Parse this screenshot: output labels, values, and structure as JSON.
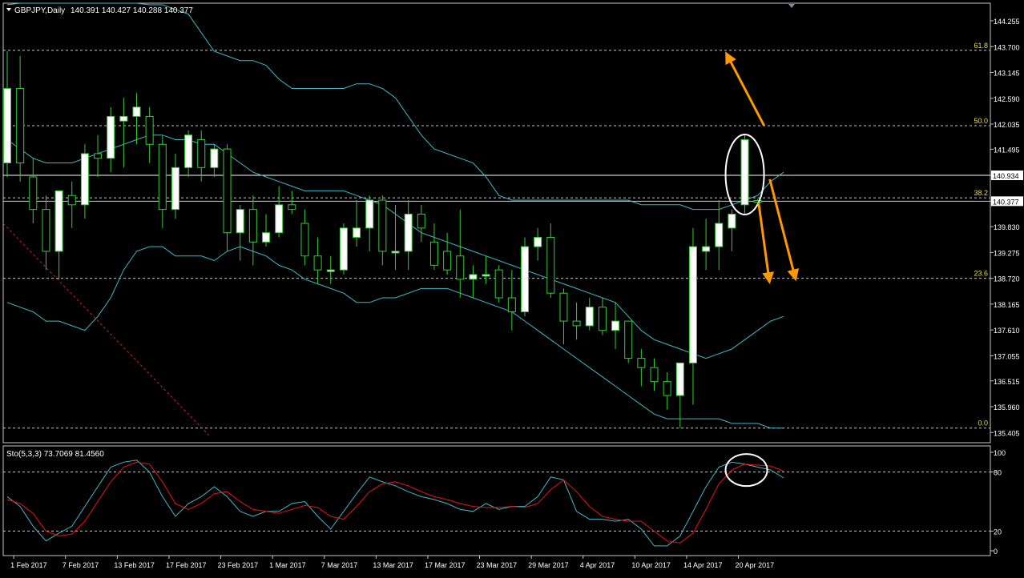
{
  "header": {
    "symbol_label": "GBPJPY,Daily",
    "ohlc_label": "140.391 140.427 140.288 140.377"
  },
  "colors": {
    "background": "#000000",
    "frame": "#c8c8c8",
    "bull_body": "#ffffff",
    "bear_body": "#000000",
    "wick": "#33cc33",
    "bollinger": "#40b8c8",
    "fib_line": "#c8c8c8",
    "fib_label": "#e8e040",
    "trendline": "#cc2222",
    "arrow": "#ff9900",
    "ellipse": "#ffffff",
    "sto_main": "#40b8c8",
    "sto_signal": "#ee1111",
    "axis_text": "#ffffff"
  },
  "chart_data": [
    {
      "type": "candlestick",
      "title": "GBPJPY,Daily",
      "ylim": [
        135.405,
        144.8
      ],
      "y_ticks": [
        "144.255",
        "143.700",
        "143.145",
        "142.590",
        "142.035",
        "141.495",
        "140.934",
        "140.377",
        "139.830",
        "139.275",
        "138.720",
        "138.165",
        "137.610",
        "137.055",
        "136.515",
        "135.960",
        "135.405"
      ],
      "x_tick_labels": [
        "1 Feb 2017",
        "7 Feb 2017",
        "13 Feb 2017",
        "17 Feb 2017",
        "23 Feb 2017",
        "1 Mar 2017",
        "7 Mar 2017",
        "13 Mar 2017",
        "17 Mar 2017",
        "23 Mar 2017",
        "29 Mar 2017",
        "4 Apr 2017",
        "10 Apr 2017",
        "14 Apr 2017",
        "20 Apr 2017"
      ],
      "highlighted_prices": [
        "140.934",
        "140.377"
      ],
      "fibonacci_levels": [
        {
          "label": "61.8",
          "price": 143.62
        },
        {
          "label": "50.0",
          "price": 142.0
        },
        {
          "label": "38.2",
          "price": 140.45
        },
        {
          "label": "23.6",
          "price": 138.72
        },
        {
          "label": "0.0",
          "price": 135.5
        }
      ],
      "candles": [
        {
          "date": "2017-01-31",
          "open": 141.2,
          "high": 143.6,
          "low": 140.9,
          "close": 142.8
        },
        {
          "date": "2017-02-01",
          "open": 142.8,
          "high": 143.5,
          "low": 140.8,
          "close": 141.2
        },
        {
          "date": "2017-02-02",
          "open": 140.9,
          "high": 141.3,
          "low": 139.9,
          "close": 140.2
        },
        {
          "date": "2017-02-03",
          "open": 140.2,
          "high": 140.5,
          "low": 138.9,
          "close": 139.3
        },
        {
          "date": "2017-02-06",
          "open": 139.3,
          "high": 140.6,
          "low": 138.7,
          "close": 140.6
        },
        {
          "date": "2017-02-07",
          "open": 140.5,
          "high": 140.8,
          "low": 139.8,
          "close": 140.3
        },
        {
          "date": "2017-02-08",
          "open": 140.3,
          "high": 141.6,
          "low": 140.0,
          "close": 141.4
        },
        {
          "date": "2017-02-09",
          "open": 141.4,
          "high": 141.8,
          "low": 140.9,
          "close": 141.3
        },
        {
          "date": "2017-02-10",
          "open": 141.3,
          "high": 142.4,
          "low": 141.0,
          "close": 142.2
        },
        {
          "date": "2017-02-13",
          "open": 142.1,
          "high": 142.6,
          "low": 141.1,
          "close": 142.2
        },
        {
          "date": "2017-02-14",
          "open": 142.2,
          "high": 142.7,
          "low": 141.6,
          "close": 142.4
        },
        {
          "date": "2017-02-15",
          "open": 142.2,
          "high": 142.4,
          "low": 141.2,
          "close": 141.6
        },
        {
          "date": "2017-02-16",
          "open": 141.6,
          "high": 141.8,
          "low": 139.8,
          "close": 140.2
        },
        {
          "date": "2017-02-17",
          "open": 140.2,
          "high": 141.4,
          "low": 140.0,
          "close": 141.1
        },
        {
          "date": "2017-02-20",
          "open": 141.1,
          "high": 141.9,
          "low": 140.9,
          "close": 141.8
        },
        {
          "date": "2017-02-21",
          "open": 141.7,
          "high": 141.9,
          "low": 140.8,
          "close": 141.1
        },
        {
          "date": "2017-02-22",
          "open": 141.1,
          "high": 141.6,
          "low": 140.9,
          "close": 141.5
        },
        {
          "date": "2017-02-23",
          "open": 141.5,
          "high": 141.6,
          "low": 139.3,
          "close": 139.7
        },
        {
          "date": "2017-02-24",
          "open": 139.7,
          "high": 140.3,
          "low": 139.1,
          "close": 140.2
        },
        {
          "date": "2017-02-27",
          "open": 140.2,
          "high": 140.5,
          "low": 139.0,
          "close": 139.5
        },
        {
          "date": "2017-02-28",
          "open": 139.5,
          "high": 140.1,
          "low": 139.4,
          "close": 139.7
        },
        {
          "date": "2017-03-01",
          "open": 139.7,
          "high": 140.7,
          "low": 139.6,
          "close": 140.3
        },
        {
          "date": "2017-03-02",
          "open": 140.3,
          "high": 140.6,
          "low": 140.1,
          "close": 140.2
        },
        {
          "date": "2017-03-03",
          "open": 139.9,
          "high": 140.2,
          "low": 139.0,
          "close": 139.2
        },
        {
          "date": "2017-03-06",
          "open": 139.2,
          "high": 139.6,
          "low": 138.6,
          "close": 138.9
        },
        {
          "date": "2017-03-07",
          "open": 138.9,
          "high": 139.2,
          "low": 138.6,
          "close": 138.9
        },
        {
          "date": "2017-03-08",
          "open": 138.9,
          "high": 139.9,
          "low": 138.8,
          "close": 139.8
        },
        {
          "date": "2017-03-09",
          "open": 139.6,
          "high": 140.4,
          "low": 139.4,
          "close": 139.8
        },
        {
          "date": "2017-03-10",
          "open": 139.8,
          "high": 140.5,
          "low": 139.3,
          "close": 140.4
        },
        {
          "date": "2017-03-13",
          "open": 140.4,
          "high": 140.5,
          "low": 139.0,
          "close": 139.3
        },
        {
          "date": "2017-03-14",
          "open": 139.3,
          "high": 140.3,
          "low": 138.9,
          "close": 139.3
        },
        {
          "date": "2017-03-15",
          "open": 139.3,
          "high": 140.4,
          "low": 138.9,
          "close": 140.1
        },
        {
          "date": "2017-03-16",
          "open": 140.1,
          "high": 140.3,
          "low": 139.5,
          "close": 139.8
        },
        {
          "date": "2017-03-17",
          "open": 139.5,
          "high": 139.9,
          "low": 138.9,
          "close": 139.0
        },
        {
          "date": "2017-03-20",
          "open": 139.3,
          "high": 139.7,
          "low": 138.8,
          "close": 138.9
        },
        {
          "date": "2017-03-21",
          "open": 139.2,
          "high": 140.2,
          "low": 138.3,
          "close": 138.7
        },
        {
          "date": "2017-03-22",
          "open": 138.7,
          "high": 139.0,
          "low": 138.3,
          "close": 138.8
        },
        {
          "date": "2017-03-23",
          "open": 138.8,
          "high": 139.2,
          "low": 138.6,
          "close": 138.8
        },
        {
          "date": "2017-03-24",
          "open": 138.9,
          "high": 139.0,
          "low": 138.2,
          "close": 138.3
        },
        {
          "date": "2017-03-27",
          "open": 138.3,
          "high": 138.9,
          "low": 137.6,
          "close": 138.0
        },
        {
          "date": "2017-03-28",
          "open": 138.0,
          "high": 139.6,
          "low": 137.9,
          "close": 139.4
        },
        {
          "date": "2017-03-29",
          "open": 139.4,
          "high": 139.8,
          "low": 139.1,
          "close": 139.6
        },
        {
          "date": "2017-03-30",
          "open": 139.6,
          "high": 139.9,
          "low": 138.3,
          "close": 138.4
        },
        {
          "date": "2017-03-31",
          "open": 138.4,
          "high": 138.5,
          "low": 137.3,
          "close": 137.8
        },
        {
          "date": "2017-04-03",
          "open": 137.8,
          "high": 138.2,
          "low": 137.4,
          "close": 137.7
        },
        {
          "date": "2017-04-04",
          "open": 137.7,
          "high": 138.3,
          "low": 137.6,
          "close": 138.1
        },
        {
          "date": "2017-04-05",
          "open": 138.1,
          "high": 138.3,
          "low": 137.5,
          "close": 137.6
        },
        {
          "date": "2017-04-06",
          "open": 137.6,
          "high": 138.2,
          "low": 137.2,
          "close": 137.8
        },
        {
          "date": "2017-04-07",
          "open": 137.8,
          "high": 137.8,
          "low": 136.9,
          "close": 137.0
        },
        {
          "date": "2017-04-10",
          "open": 137.0,
          "high": 137.2,
          "low": 136.4,
          "close": 136.8
        },
        {
          "date": "2017-04-11",
          "open": 136.8,
          "high": 137.0,
          "low": 136.3,
          "close": 136.5
        },
        {
          "date": "2017-04-12",
          "open": 136.5,
          "high": 136.7,
          "low": 135.9,
          "close": 136.2
        },
        {
          "date": "2017-04-13",
          "open": 136.2,
          "high": 136.9,
          "low": 135.5,
          "close": 136.9
        },
        {
          "date": "2017-04-14",
          "open": 136.9,
          "high": 139.8,
          "low": 136.0,
          "close": 139.4
        },
        {
          "date": "2017-04-17",
          "open": 139.3,
          "high": 140.0,
          "low": 138.9,
          "close": 139.4
        },
        {
          "date": "2017-04-18",
          "open": 139.4,
          "high": 140.4,
          "low": 138.9,
          "close": 139.9
        },
        {
          "date": "2017-04-19",
          "open": 139.8,
          "high": 140.2,
          "low": 139.3,
          "close": 140.1
        },
        {
          "date": "2017-04-20",
          "open": 140.3,
          "high": 141.8,
          "low": 140.1,
          "close": 141.7
        },
        {
          "date": "2017-04-21",
          "open": 140.391,
          "high": 140.427,
          "low": 140.288,
          "close": 140.377
        }
      ],
      "bollinger": {
        "upper": [
          144.6,
          144.7,
          144.7,
          144.7,
          144.7,
          144.7,
          144.7,
          144.7,
          144.7,
          144.7,
          144.7,
          144.6,
          144.6,
          144.5,
          144.4,
          144.0,
          143.6,
          143.5,
          143.4,
          143.4,
          143.3,
          143.0,
          142.8,
          142.8,
          142.8,
          142.8,
          142.8,
          142.9,
          142.9,
          142.8,
          142.6,
          142.2,
          141.8,
          141.5,
          141.4,
          141.3,
          141.2,
          140.9,
          140.5,
          140.4,
          140.4,
          140.4,
          140.4,
          140.4,
          140.4,
          140.4,
          140.4,
          140.4,
          140.4,
          140.3,
          140.3,
          140.3,
          140.3,
          140.2,
          140.2,
          140.2,
          140.3,
          140.4,
          140.5,
          140.8,
          141.0
        ],
        "middle": [
          141.7,
          141.5,
          141.3,
          141.2,
          141.2,
          141.2,
          141.3,
          141.4,
          141.5,
          141.6,
          141.7,
          141.8,
          141.8,
          141.7,
          141.7,
          141.6,
          141.6,
          141.4,
          141.2,
          141.0,
          140.9,
          140.8,
          140.7,
          140.6,
          140.6,
          140.6,
          140.6,
          140.5,
          140.4,
          140.3,
          140.1,
          139.9,
          139.7,
          139.6,
          139.5,
          139.4,
          139.3,
          139.2,
          139.1,
          139.0,
          138.9,
          138.8,
          138.7,
          138.6,
          138.5,
          138.4,
          138.3,
          138.2,
          137.9,
          137.6,
          137.4,
          137.3,
          137.2,
          137.1,
          137.0,
          137.1,
          137.2,
          137.4,
          137.6,
          137.8,
          137.9
        ],
        "lower": [
          138.2,
          138.1,
          138.0,
          137.8,
          137.8,
          137.7,
          137.6,
          137.9,
          138.3,
          138.9,
          139.3,
          139.4,
          139.4,
          139.2,
          139.2,
          139.2,
          139.1,
          139.3,
          139.4,
          139.3,
          139.2,
          139.0,
          138.9,
          138.7,
          138.6,
          138.5,
          138.4,
          138.2,
          138.2,
          138.3,
          138.3,
          138.4,
          138.5,
          138.5,
          138.5,
          138.4,
          138.3,
          138.2,
          138.1,
          138.0,
          137.8,
          137.6,
          137.4,
          137.2,
          137.0,
          136.8,
          136.6,
          136.4,
          136.2,
          136.0,
          135.8,
          135.7,
          135.7,
          135.7,
          135.7,
          135.7,
          135.6,
          135.6,
          135.6,
          135.5,
          135.5
        ]
      }
    },
    {
      "type": "line",
      "title": "Sto(5,3,3) 73.7069 81.4560",
      "ylim": [
        0,
        100
      ],
      "y_ticks": [
        "100",
        "80",
        "20",
        "0"
      ],
      "levels": [
        80,
        20
      ],
      "series": [
        {
          "name": "Sto(5,3,3) 73.7069",
          "values": [
            55,
            45,
            25,
            10,
            18,
            25,
            45,
            65,
            85,
            90,
            92,
            80,
            55,
            35,
            48,
            55,
            65,
            55,
            40,
            35,
            40,
            40,
            48,
            50,
            35,
            22,
            40,
            58,
            75,
            70,
            66,
            60,
            55,
            52,
            48,
            42,
            40,
            48,
            42,
            45,
            45,
            55,
            75,
            72,
            40,
            32,
            32,
            30,
            32,
            22,
            5,
            5,
            15,
            40,
            65,
            85,
            90,
            88,
            85,
            82,
            74
          ]
        },
        {
          "name": "81.4560",
          "values": [
            52,
            48,
            38,
            20,
            15,
            17,
            30,
            50,
            70,
            85,
            90,
            88,
            70,
            48,
            42,
            48,
            58,
            60,
            50,
            42,
            40,
            38,
            42,
            46,
            44,
            35,
            32,
            45,
            60,
            68,
            70,
            66,
            60,
            55,
            52,
            48,
            45,
            44,
            44,
            45,
            44,
            48,
            62,
            72,
            60,
            45,
            35,
            32,
            30,
            30,
            20,
            10,
            8,
            18,
            42,
            68,
            82,
            88,
            87,
            86,
            81
          ]
        }
      ]
    }
  ]
}
